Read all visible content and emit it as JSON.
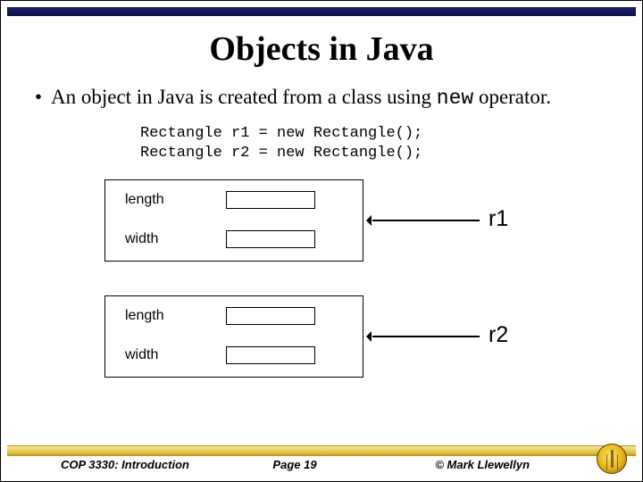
{
  "title": "Objects in Java",
  "bullet": {
    "dot": "•",
    "text_prefix": "An object in Java is created from a class using ",
    "operator": "new",
    "text_suffix": " operator."
  },
  "code": "Rectangle r1 = new Rectangle();\nRectangle r2 = new Rectangle();",
  "objects": [
    {
      "field1": "length",
      "field2": "width",
      "pointer": "r1"
    },
    {
      "field1": "length",
      "field2": "width",
      "pointer": "r2"
    }
  ],
  "footer": {
    "left": "COP 3330:  Introduction",
    "mid_prefix": "Page ",
    "page": "19",
    "right": "© Mark Llewellyn"
  }
}
